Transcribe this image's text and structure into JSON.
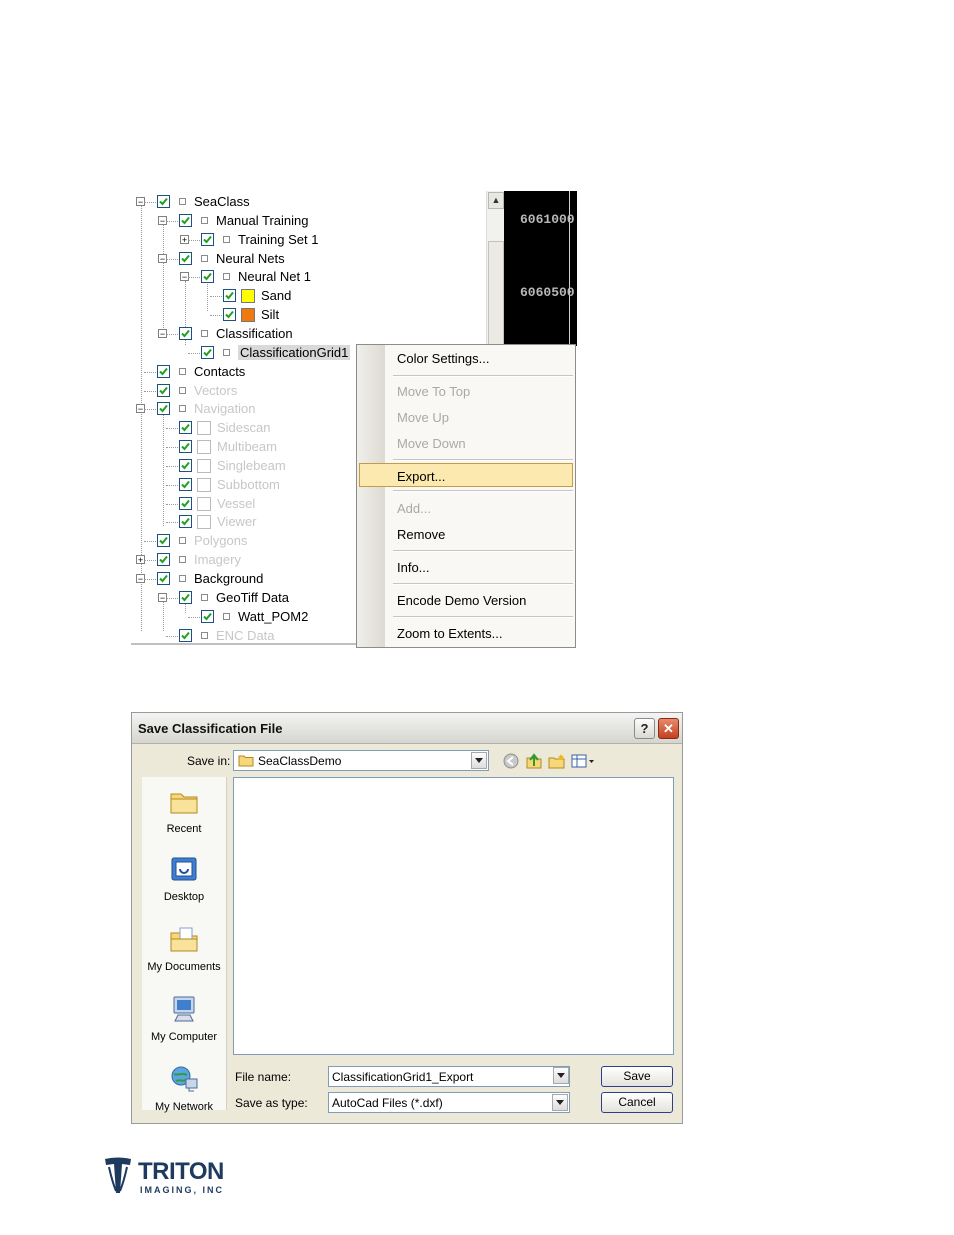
{
  "tree": {
    "nodes": [
      {
        "label": "SeaClass",
        "state": "normal"
      },
      {
        "label": "Manual Training",
        "state": "normal"
      },
      {
        "label": "Training Set 1",
        "state": "normal"
      },
      {
        "label": "Neural Nets",
        "state": "normal"
      },
      {
        "label": "Neural Net 1",
        "state": "normal"
      },
      {
        "label": "Sand",
        "state": "normal",
        "swatch": "#ffff00"
      },
      {
        "label": "Silt",
        "state": "normal",
        "swatch": "#f07a10"
      },
      {
        "label": "Classification",
        "state": "normal"
      },
      {
        "label": "ClassificationGrid1",
        "state": "selected"
      },
      {
        "label": "Contacts",
        "state": "normal"
      },
      {
        "label": "Vectors",
        "state": "disabled"
      },
      {
        "label": "Navigation",
        "state": "disabled"
      },
      {
        "label": "Sidescan",
        "state": "disabled"
      },
      {
        "label": "Multibeam",
        "state": "disabled"
      },
      {
        "label": "Singlebeam",
        "state": "disabled"
      },
      {
        "label": "Subbottom",
        "state": "disabled"
      },
      {
        "label": "Vessel",
        "state": "disabled"
      },
      {
        "label": "Viewer",
        "state": "disabled"
      },
      {
        "label": "Polygons",
        "state": "disabled"
      },
      {
        "label": "Imagery",
        "state": "disabled"
      },
      {
        "label": "Background",
        "state": "normal"
      },
      {
        "label": "GeoTiff Data",
        "state": "normal"
      },
      {
        "label": "Watt_POM2",
        "state": "normal"
      },
      {
        "label": "ENC Data",
        "state": "disabled"
      }
    ],
    "map_coords": [
      "6061000",
      "6060500"
    ]
  },
  "context_menu": {
    "items": [
      {
        "label": "Color Settings...",
        "state": "enabled"
      },
      {
        "label": "Move To Top",
        "state": "disabled"
      },
      {
        "label": "Move Up",
        "state": "disabled"
      },
      {
        "label": "Move Down",
        "state": "disabled"
      },
      {
        "label": "Export...",
        "state": "highlighted"
      },
      {
        "label": "Add...",
        "state": "disabled"
      },
      {
        "label": "Remove",
        "state": "enabled"
      },
      {
        "label": "Info...",
        "state": "enabled"
      },
      {
        "label": "Encode Demo Version",
        "state": "enabled"
      },
      {
        "label": "Zoom to Extents...",
        "state": "enabled"
      }
    ]
  },
  "dialog": {
    "title": "Save Classification File",
    "help_glyph": "?",
    "close_glyph": "✕",
    "save_in_label": "Save in:",
    "save_in_value": "SeaClassDemo",
    "places": [
      {
        "label": "Recent",
        "icon": "recent-folder-icon"
      },
      {
        "label": "Desktop",
        "icon": "desktop-icon"
      },
      {
        "label": "My Documents",
        "icon": "my-documents-icon"
      },
      {
        "label": "My Computer",
        "icon": "my-computer-icon"
      },
      {
        "label": "My Network",
        "icon": "my-network-icon"
      }
    ],
    "file_name_label": "File name:",
    "file_name_value": "ClassificationGrid1_Export",
    "save_type_label": "Save as type:",
    "save_type_value": "AutoCad Files (*.dxf)",
    "save_button": "Save",
    "cancel_button": "Cancel"
  },
  "logo": {
    "name": "TRITON",
    "subtitle": "IMAGING, INC"
  }
}
